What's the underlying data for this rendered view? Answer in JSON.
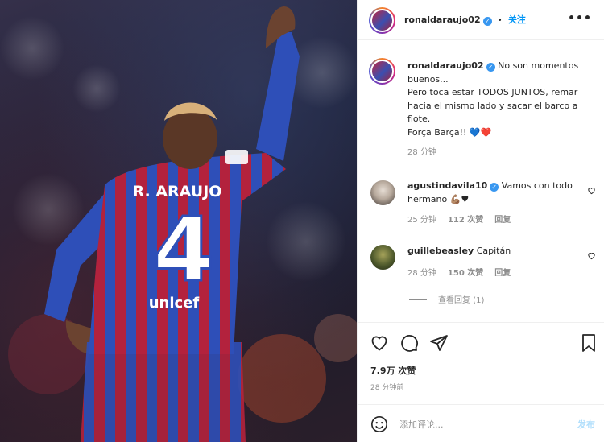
{
  "header": {
    "username": "ronaldaraujo02",
    "separator": "•",
    "follow_label": "关注",
    "more_icon": "more-horizontal-icon"
  },
  "photo": {
    "jersey_name": "R. ARAUJO",
    "jersey_number": "4",
    "sponsor": "unicef",
    "colors": {
      "blaugrana_blue": "#2e4fb8",
      "blaugrana_red": "#b3223d"
    }
  },
  "caption": {
    "username": "ronaldaraujo02",
    "lines": [
      "No son momentos",
      "buenos...",
      "Pero toca estar TODOS JUNTOS, remar",
      "hacia el mismo lado y sacar el barco a",
      "flote.",
      "Força Barça!! 💙❤️"
    ],
    "time": "28 分钟"
  },
  "comments": [
    {
      "username": "agustindavila10",
      "verified": true,
      "text_line1": "Vamos con todo",
      "text_line2": "hermano 💪🏽♥",
      "time": "25 分钟",
      "likes": "112 次赞",
      "reply": "回复"
    },
    {
      "username": "guillebeasley",
      "verified": false,
      "text_line1": "Capitán",
      "time": "28 分钟",
      "likes": "150 次赞",
      "reply": "回复"
    }
  ],
  "view_replies": "查看回复 (1)",
  "actions": {
    "like_icon": "heart-icon",
    "comment_icon": "comment-icon",
    "share_icon": "send-icon",
    "save_icon": "bookmark-icon"
  },
  "likes_count": "7.9万 次赞",
  "posted_ago": "28 分钟前",
  "add_comment": {
    "emoji_icon": "smiley-icon",
    "placeholder": "添加评论...",
    "post_label": "发布"
  }
}
